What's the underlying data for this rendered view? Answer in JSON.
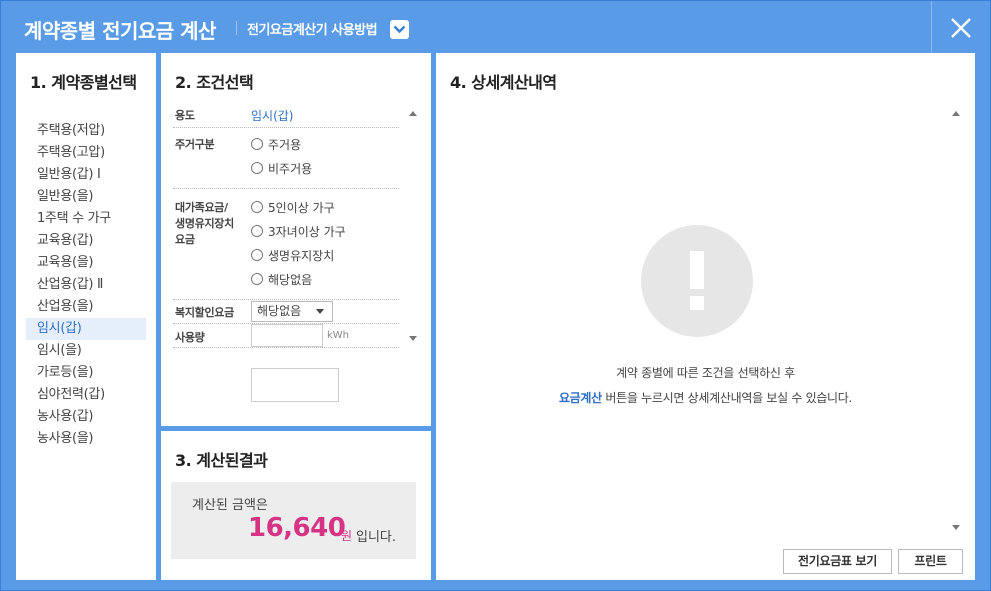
{
  "header": {
    "title": "계약종별 전기요금 계산",
    "guide_label": "전기요금계산기 사용방법"
  },
  "panel1": {
    "title": "1. 계약종별선택",
    "items": [
      "주택용(저압)",
      "주택용(고압)",
      "일반용(갑) Ⅰ",
      "일반용(을)",
      "1주택 수 가구",
      "교육용(갑)",
      "교육용(을)",
      "산업용(갑) Ⅱ",
      "산업용(을)",
      "임시(갑)",
      "임시(을)",
      "가로등(을)",
      "심야전력(갑)",
      "농사용(갑)",
      "농사용(을)"
    ],
    "selected_index": 9
  },
  "panel2": {
    "title": "2. 조건선택",
    "usage_label": "용도",
    "usage_value": "임시(갑)",
    "residence_label": "주거구분",
    "residence_options": [
      "주거용",
      "비주거용"
    ],
    "discount_label_line1": "대가족요금/",
    "discount_label_line2": "생명유지장치",
    "discount_label_line3": "요금",
    "discount_options": [
      "5인이상 가구",
      "3자녀이상 가구",
      "생명유지장치",
      "해당없음"
    ],
    "welfare_label": "복지할인요금",
    "welfare_value": "해당없음",
    "amount_label": "사용량",
    "amount_unit": "kWh"
  },
  "panel3": {
    "title": "3. 계산된결과",
    "lead": "계산된 금액은",
    "amount": "16,640",
    "unit": "원",
    "tail": "입니다."
  },
  "panel4": {
    "title": "4. 상세계산내역",
    "info_line1": "계약 종별에 따른 조건을 선택하신 후",
    "info_highlight": "요금계산",
    "info_line2_rest": " 버튼을 누르시면 상세계산내역을 보실 수 있습니다.",
    "btn_table": "전기요금표 보기",
    "btn_print": "프린트"
  },
  "colors": {
    "header_bg": "#5a9be8",
    "accent_blue": "#2e6fc8",
    "amount_pink": "#d63384",
    "selected_bg": "#e5effb"
  }
}
